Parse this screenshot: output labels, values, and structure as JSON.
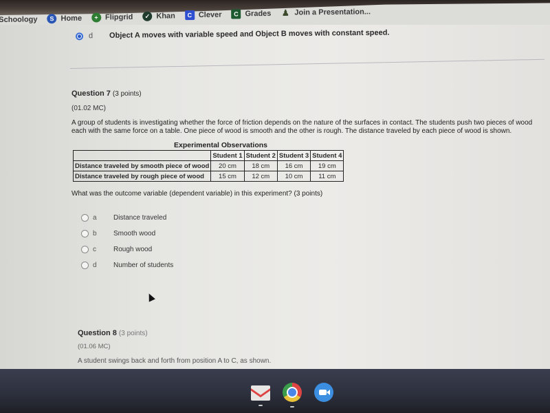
{
  "bookmarks": [
    {
      "label": "Schoology",
      "icon": "schoology-icon"
    },
    {
      "label": "Home",
      "icon": "schoology-s-icon",
      "color": "#2a57b5",
      "glyph": "S"
    },
    {
      "label": "Flipgrid",
      "icon": "flipgrid-plus-icon",
      "color": "#2e7d32",
      "glyph": "+"
    },
    {
      "label": "Khan",
      "icon": "khan-academy-icon",
      "color": "#1e3b2e",
      "glyph": "✓"
    },
    {
      "label": "Clever",
      "icon": "clever-icon",
      "color": "#2e4fd0",
      "glyph": "C"
    },
    {
      "label": "Grades",
      "icon": "grades-icon",
      "color": "#1e5a30",
      "glyph": "C"
    },
    {
      "label": "Join a Presentation...",
      "icon": "nearpod-icon",
      "color": "#3a4a2a",
      "glyph": "♟"
    }
  ],
  "previous_question": {
    "selected_letter": "d",
    "selected_text": "Object A moves with variable speed and Object B moves with constant speed."
  },
  "question7": {
    "title": "Question 7",
    "points": "(3 points)",
    "code": "(01.02 MC)",
    "body": "A group of students is investigating whether the force of friction depends on the nature of the surfaces in contact. The students push two pieces of wood each with the same force on a table. One piece of wood is smooth and the other is rough. The distance traveled by each piece of wood is shown.",
    "table": {
      "caption": "Experimental Observations",
      "headers": [
        "",
        "Student 1",
        "Student 2",
        "Student 3",
        "Student 4"
      ],
      "rows": [
        {
          "label": "Distance traveled by smooth piece of wood",
          "values": [
            "20 cm",
            "18 cm",
            "16 cm",
            "19 cm"
          ]
        },
        {
          "label": "Distance traveled by rough piece of wood",
          "values": [
            "15 cm",
            "12 cm",
            "10 cm",
            "11 cm"
          ]
        }
      ]
    },
    "prompt": "What was the outcome variable (dependent variable) in this experiment? (3 points)",
    "options": [
      {
        "letter": "a",
        "text": "Distance traveled",
        "selected": false
      },
      {
        "letter": "b",
        "text": "Smooth wood",
        "selected": false
      },
      {
        "letter": "c",
        "text": "Rough wood",
        "selected": false
      },
      {
        "letter": "d",
        "text": "Number of students",
        "selected": false
      }
    ]
  },
  "question8": {
    "title": "Question 8",
    "points": "(3 points)",
    "code": "(01.06 MC)",
    "body": "A student swings back and forth from position A to C, as shown."
  },
  "taskbar": {
    "apps": [
      {
        "name": "gmail-icon"
      },
      {
        "name": "chrome-icon"
      },
      {
        "name": "zoom-icon"
      }
    ]
  }
}
